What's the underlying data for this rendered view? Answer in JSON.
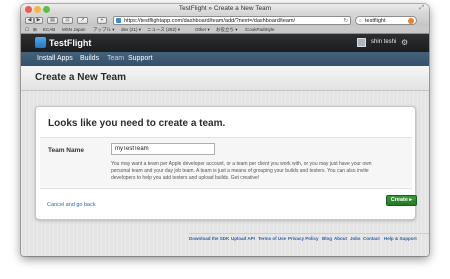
{
  "browser": {
    "window_title": "TestFlight » Create a New Team",
    "url": "https://testflightapp.com/dashboard/team/add/?next=/dashboard/team/",
    "search_value": "testflight",
    "bookmarks": [
      "ECAB",
      "MSN Japan",
      "アップル ▾",
      "dev (21) ▾",
      "ニュース (252) ▾",
      "Other ▾",
      "お役立ち ▾",
      "iCookPadStyle"
    ]
  },
  "app": {
    "logo": "TestFlight",
    "user_name": "shin teshi",
    "nav": [
      "Install Apps",
      "Builds",
      "Team",
      "Support"
    ],
    "active_nav": "Team"
  },
  "page": {
    "title": "Create a New Team",
    "heading": "Looks like you need to create a team.",
    "team_name_label": "Team Name",
    "team_name_value": "myTestTeam",
    "help_text": "You may want a team per Apple developer account, or a team per client you work with, or you may just have your own personal team and your day job team. A team is just a means of grouping your builds and testers. You can also invite developers to help you add testers and upload builds. Get creative!",
    "cancel_link": "Cancel and go back",
    "create_button": "Create ▸"
  },
  "footer": {
    "links": [
      "Download the SDK",
      "Upload API",
      "Terms of Use",
      "Privacy Policy",
      "Blog",
      "About",
      "Jobs",
      "Contact",
      "Help & Support"
    ]
  },
  "colors": {
    "header_bg": "#1f2021",
    "nav_bg": "#3b5870",
    "create_button": "#2a8a2d",
    "link": "#2d66b5"
  },
  "icons": {
    "traffic_lights": [
      "close-light",
      "minimize-light",
      "zoom-light"
    ],
    "toolbar": [
      "back-icon",
      "forward-icon",
      "sidebar-icon",
      "reader-icon",
      "share-icon",
      "add-tab-icon"
    ]
  }
}
